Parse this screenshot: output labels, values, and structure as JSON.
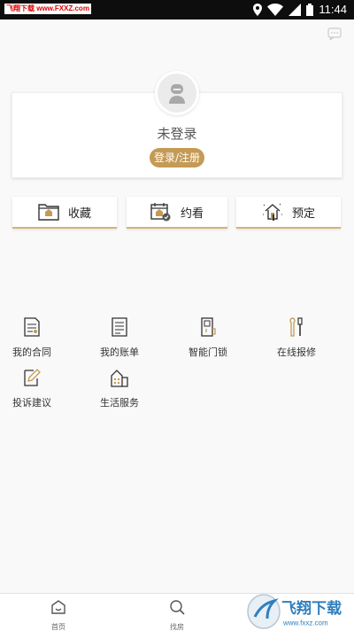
{
  "status_bar": {
    "watermark_text": "飞翔下载 www.FXXZ.com",
    "time": "11:44"
  },
  "profile": {
    "login_state": "未登录",
    "login_button": "登录/注册"
  },
  "actions": [
    {
      "label": "收藏",
      "icon": "folder-icon"
    },
    {
      "label": "约看",
      "icon": "calendar-icon"
    },
    {
      "label": "预定",
      "icon": "house-hand-icon"
    }
  ],
  "services": [
    {
      "label": "我的合同",
      "icon": "contract-icon"
    },
    {
      "label": "我的账单",
      "icon": "bill-icon"
    },
    {
      "label": "智能门锁",
      "icon": "door-lock-icon"
    },
    {
      "label": "在线报修",
      "icon": "repair-tools-icon"
    },
    {
      "label": "投诉建议",
      "icon": "feedback-edit-icon"
    },
    {
      "label": "生活服务",
      "icon": "life-service-icon"
    }
  ],
  "bottom_nav": [
    {
      "label": "首页",
      "icon": "home-icon"
    },
    {
      "label": "找房",
      "icon": "search-icon"
    }
  ],
  "watermark_logo_text": "飞翔下载",
  "colors": {
    "accent": "#c59a55",
    "background": "#f9f9f9",
    "status_bar": "#0d0d0d"
  }
}
